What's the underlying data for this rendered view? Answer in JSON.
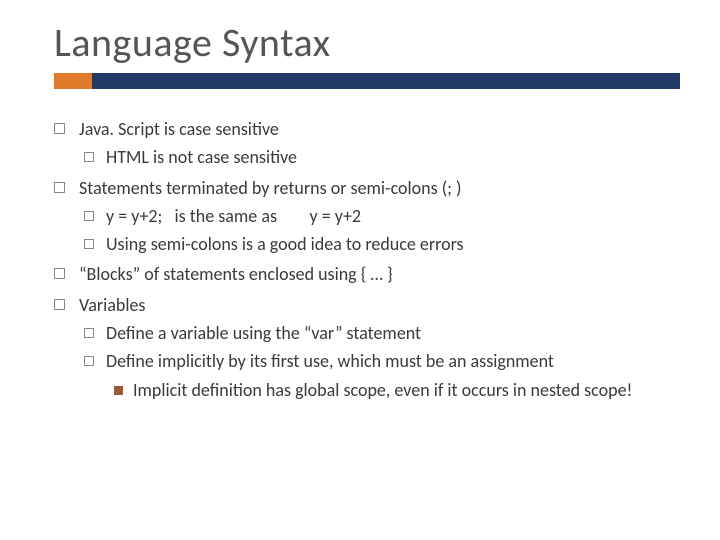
{
  "title": "Language Syntax",
  "items": [
    {
      "text": "Java. Script is case sensitive",
      "children": [
        {
          "text": "HTML is not case sensitive"
        }
      ]
    },
    {
      "text": "Statements terminated by returns or semi-colons (; )",
      "children": [
        {
          "text": "y = y+2;   is the same as        y = y+2"
        },
        {
          "text": "Using semi-colons is a good idea to reduce errors"
        }
      ]
    },
    {
      "text": "“Blocks” of statements enclosed using  { … }"
    },
    {
      "text": "Variables",
      "children": [
        {
          "text": "Define a variable using the “var” statement"
        },
        {
          "text": "Define implicitly by its first use, which must be an assignment",
          "children": [
            {
              "text": "Implicit definition has global scope, even if it occurs in nested scope!"
            }
          ]
        }
      ]
    }
  ]
}
